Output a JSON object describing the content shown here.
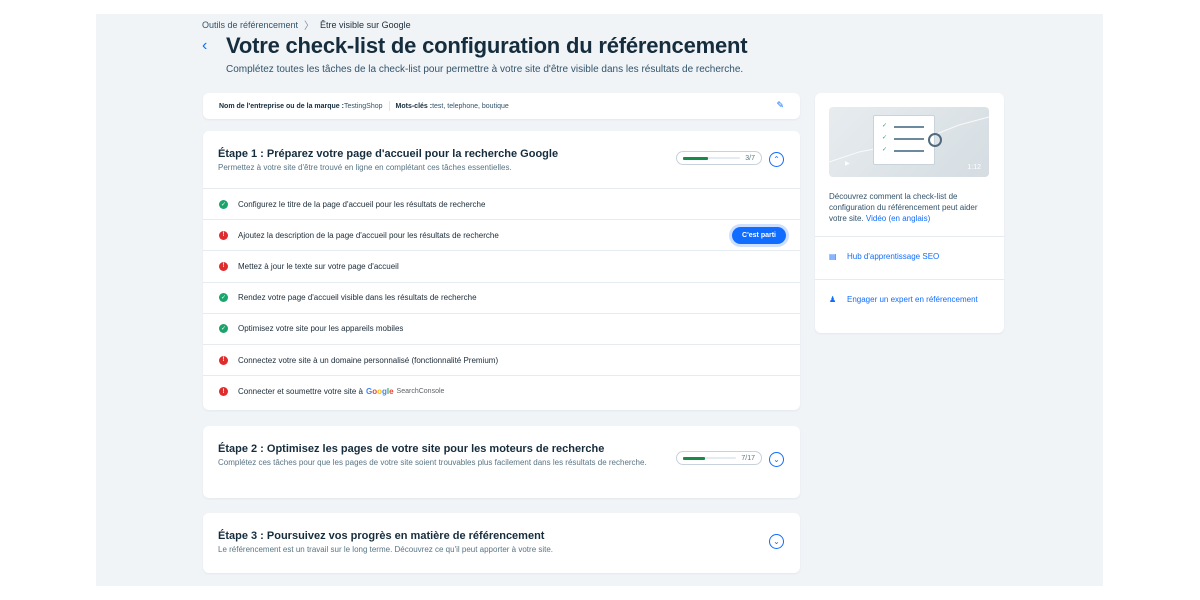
{
  "breadcrumb": {
    "parent": "Outils de référencement",
    "separator": "〉",
    "current": "Être visible sur Google"
  },
  "header": {
    "title": "Votre check-list de configuration du référencement",
    "subtitle": "Complétez toutes les tâches de la check-list pour permettre à votre site d'être visible dans les résultats de recherche."
  },
  "business": {
    "name_label": "Nom de l'entreprise ou de la marque :",
    "name_value": " TestingShop",
    "keywords_label": "Mots-clés :",
    "keywords_value": " test, telephone, boutique"
  },
  "steps": [
    {
      "title": "Étape 1 : Préparez votre page d'accueil pour la recherche Google",
      "desc": "Permettez à votre site d'être trouvé en ligne en complétant ces tâches essentielles.",
      "count": "3/7",
      "progress": 0.43,
      "expanded": true,
      "tasks": [
        {
          "label": "Configurez le titre de la page d'accueil pour les résultats de recherche",
          "status": "done"
        },
        {
          "label": "Ajoutez la description de la page d'accueil pour les résultats de recherche",
          "status": "todo"
        },
        {
          "label": "Mettez à jour le texte sur votre page d'accueil",
          "status": "todo"
        },
        {
          "label": "Rendez votre page d'accueil visible dans les résultats de recherche",
          "status": "done"
        },
        {
          "label": "Optimisez votre site pour les appareils mobiles",
          "status": "done"
        },
        {
          "label": "Connectez votre site à un domaine personnalisé (fonctionnalité Premium)",
          "status": "todo"
        },
        {
          "label": "Connecter et soumettre votre site à",
          "status": "todo"
        }
      ],
      "cta": "C'est parti"
    },
    {
      "title": "Étape 2 : Optimisez les pages de votre site pour les moteurs de recherche",
      "desc": "Complétez ces tâches pour que les pages de votre site soient trouvables plus facilement dans les résultats de recherche.",
      "count": "7/17",
      "progress": 0.41
    },
    {
      "title": "Étape 3 : Poursuivez vos progrès en matière de référencement",
      "desc": "Le référencement est un travail sur le long terme. Découvrez ce qu'il peut apporter à votre site."
    }
  ],
  "google_brand": {
    "letters": [
      "G",
      "o",
      "o",
      "g",
      "l",
      "e"
    ],
    "product": "SearchConsole"
  },
  "sidebar": {
    "video_duration": "1:12",
    "video_text": "Découvrez comment la check-list de configuration du référencement peut aider votre site. ",
    "video_link": "Vidéo (en anglais)",
    "links": [
      {
        "label": "Hub d'apprentissage SEO",
        "icon": "book-icon"
      },
      {
        "label": "Engager un expert en référencement",
        "icon": "people-icon"
      }
    ]
  },
  "colors": {
    "accent": "#116dff",
    "done": "#1aa56b",
    "todo": "#e02c2c",
    "background": "#f0f4f7"
  }
}
